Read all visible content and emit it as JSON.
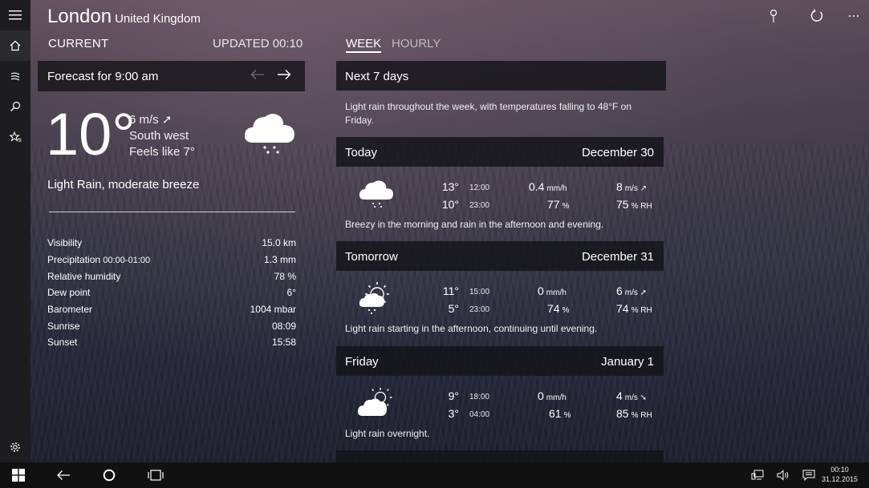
{
  "location": {
    "city": "London",
    "country": "United Kingdom"
  },
  "current": {
    "label": "CURRENT",
    "updated": "UPDATED 00:10",
    "forecast_for": "Forecast for 9:00 am",
    "temperature": "10°",
    "wind": "6 m/s ➚",
    "wind_direction": "South west",
    "feels_like": "Feels like 7°",
    "condition": "Light Rain, moderate breeze",
    "icon": "cloud-rain-icon",
    "details": [
      {
        "label": "Visibility",
        "note": "",
        "value": "15.0 km"
      },
      {
        "label": "Precipitation",
        "note": "00:00-01:00",
        "value": "1.3 mm"
      },
      {
        "label": "Relative humidity",
        "note": "",
        "value": "78 %"
      },
      {
        "label": "Dew point",
        "note": "",
        "value": "6°"
      },
      {
        "label": "Barometer",
        "note": "",
        "value": "1004 mbar"
      },
      {
        "label": "Sunrise",
        "note": "",
        "value": "08:09"
      },
      {
        "label": "Sunset",
        "note": "",
        "value": "15:58"
      }
    ]
  },
  "tabs": {
    "week": "WEEK",
    "hourly": "HOURLY",
    "active": "week"
  },
  "week": {
    "header": "Next 7 days",
    "summary": "Light rain throughout the week, with temperatures falling to 48°F on Friday.",
    "days": [
      {
        "name": "Today",
        "date": "December 30",
        "icon": "cloud-rain-icon",
        "hi": "13°",
        "hi_time": "12:00",
        "lo": "10°",
        "lo_time": "23:00",
        "precip": "0.4",
        "precip_unit": "mm/h",
        "humidity": "77",
        "humidity_unit": "%",
        "wind": "8",
        "wind_unit": "m/s ↗",
        "rh": "75",
        "rh_unit": "% RH",
        "text": "Breezy in the morning and rain in the afternoon and evening."
      },
      {
        "name": "Tomorrow",
        "date": "December 31",
        "icon": "sun-cloud-rain-icon",
        "hi": "11°",
        "hi_time": "15:00",
        "lo": "5°",
        "lo_time": "23:00",
        "precip": "0",
        "precip_unit": "mm/h",
        "humidity": "74",
        "humidity_unit": "%",
        "wind": "6",
        "wind_unit": "m/s ➚",
        "rh": "74",
        "rh_unit": "% RH",
        "text": "Light rain starting in the afternoon, continuing until evening."
      },
      {
        "name": "Friday",
        "date": "January 1",
        "icon": "partly-cloudy-icon",
        "hi": "9°",
        "hi_time": "18:00",
        "lo": "3°",
        "lo_time": "04:00",
        "precip": "0",
        "precip_unit": "mm/h",
        "humidity": "61",
        "humidity_unit": "%",
        "wind": "4",
        "wind_unit": "m/s ➘",
        "rh": "85",
        "rh_unit": "% RH",
        "text": "Light rain overnight."
      }
    ]
  },
  "taskbar": {
    "time": "00:10",
    "date": "31.12.2015"
  }
}
